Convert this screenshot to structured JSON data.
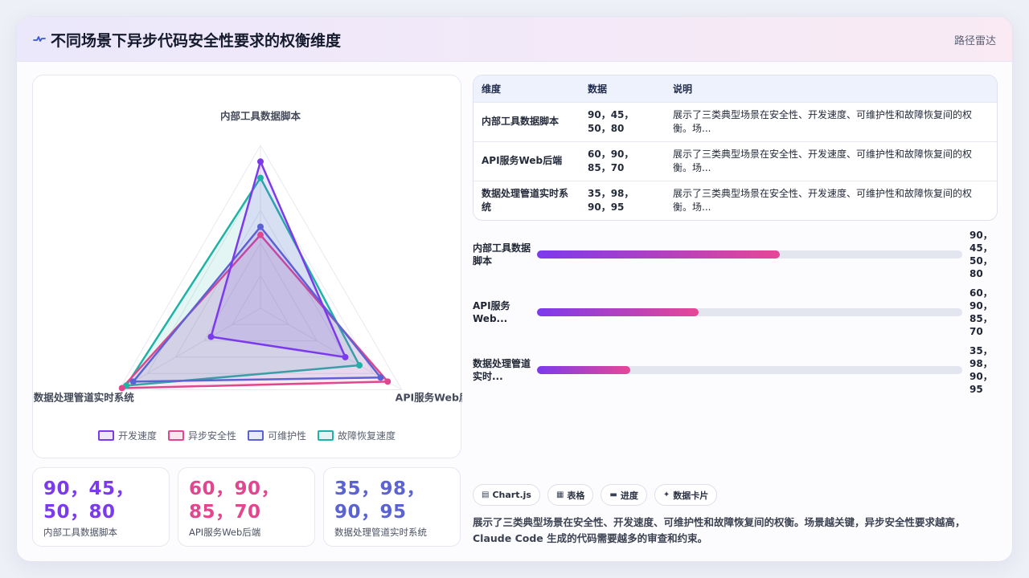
{
  "header": {
    "logo_icon": "pulse-line-icon",
    "title": "不同场景下异步代码安全性要求的权衡维度",
    "chart_type_label": "路径雷达"
  },
  "chart_data": {
    "type": "radar",
    "axes": [
      "内部工具数据脚本",
      "API服务Web后端",
      "数据处理管道实时系统"
    ],
    "range": [
      0,
      100
    ],
    "series": [
      {
        "name": "开发速度",
        "color": "#7c3aed",
        "values": [
          90,
          60,
          35
        ]
      },
      {
        "name": "异步安全性",
        "color": "#e0478f",
        "values": [
          45,
          90,
          98
        ]
      },
      {
        "name": "可维护性",
        "color": "#5b63d3",
        "values": [
          50,
          85,
          90
        ]
      },
      {
        "name": "故障恢复速度",
        "color": "#1fb3a5",
        "values": [
          80,
          70,
          95
        ]
      }
    ],
    "legend_position": "bottom",
    "grid": true
  },
  "kpis": [
    {
      "value": "90，45，50，80",
      "label": "内部工具数据脚本",
      "color": "#7c3aed"
    },
    {
      "value": "60，90，85，70",
      "label": "API服务Web后端",
      "color": "#e0478f"
    },
    {
      "value": "35，98，90，95",
      "label": "数据处理管道实时系统",
      "color": "#5b63d3"
    }
  ],
  "table": {
    "headers": [
      "维度",
      "数据",
      "说明"
    ],
    "rows": [
      {
        "dimension": "内部工具数据脚本",
        "data": "90，45，50，80",
        "desc": "展示了三类典型场景在安全性、开发速度、可维护性和故障恢复间的权衡。场..."
      },
      {
        "dimension": "API服务Web后端",
        "data": "60，90，85，70",
        "desc": "展示了三类典型场景在安全性、开发速度、可维护性和故障恢复间的权衡。场..."
      },
      {
        "dimension": "数据处理管道实时系统",
        "data": "35，98，90，95",
        "desc": "展示了三类典型场景在安全性、开发速度、可维护性和故障恢复间的权衡。场..."
      }
    ]
  },
  "progress": [
    {
      "name": "内部工具数据脚本",
      "value": "90，45，50，80",
      "fill_percent": 57
    },
    {
      "name": "API服务Web...",
      "value": "60，90，85，70",
      "fill_percent": 38
    },
    {
      "name": "数据处理管道实时...",
      "value": "35，98，90，95",
      "fill_percent": 22
    }
  ],
  "chips": [
    {
      "icon": "chart-icon",
      "glyph": "▤",
      "label": "Chart.js"
    },
    {
      "icon": "table-icon",
      "glyph": "▦",
      "label": "表格"
    },
    {
      "icon": "progress-icon",
      "glyph": "▬",
      "label": "进度"
    },
    {
      "icon": "card-icon",
      "glyph": "✦",
      "label": "数据卡片"
    }
  ],
  "footnote": "展示了三类典型场景在安全性、开发速度、可维护性和故障恢复间的权衡。场景越关键，异步安全性要求越高，Claude Code 生成的代码需要越多的审查和约束。"
}
